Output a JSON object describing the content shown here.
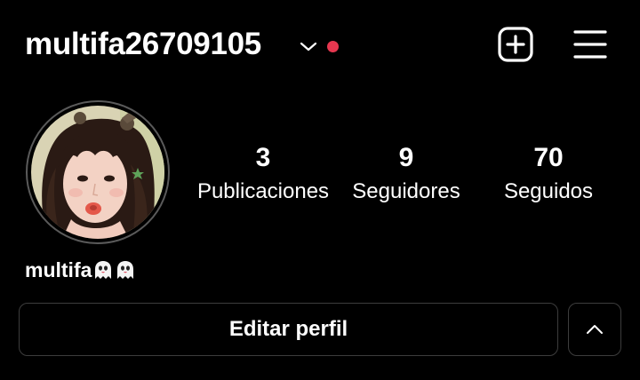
{
  "header": {
    "username": "multifa26709105",
    "chevron_icon": "chevron-down-icon",
    "notification_dot_color": "#e6374f",
    "new_post_icon": "plus-square-icon",
    "menu_icon": "hamburger-menu-icon"
  },
  "profile": {
    "avatar_icon": "profile-avatar",
    "display_name": "multifa",
    "display_name_emoji": [
      "ghost-emoji",
      "ghost-emoji"
    ]
  },
  "stats": [
    {
      "value": "3",
      "label": "Publicaciones"
    },
    {
      "value": "9",
      "label": "Seguidores"
    },
    {
      "value": "70",
      "label": "Seguidos"
    }
  ],
  "actions": {
    "edit_profile_label": "Editar perfil",
    "expand_icon": "chevron-up-icon"
  },
  "colors": {
    "background": "#000000",
    "text": "#ffffff",
    "border": "#3d3d3d",
    "accent_dot": "#e6374f"
  }
}
